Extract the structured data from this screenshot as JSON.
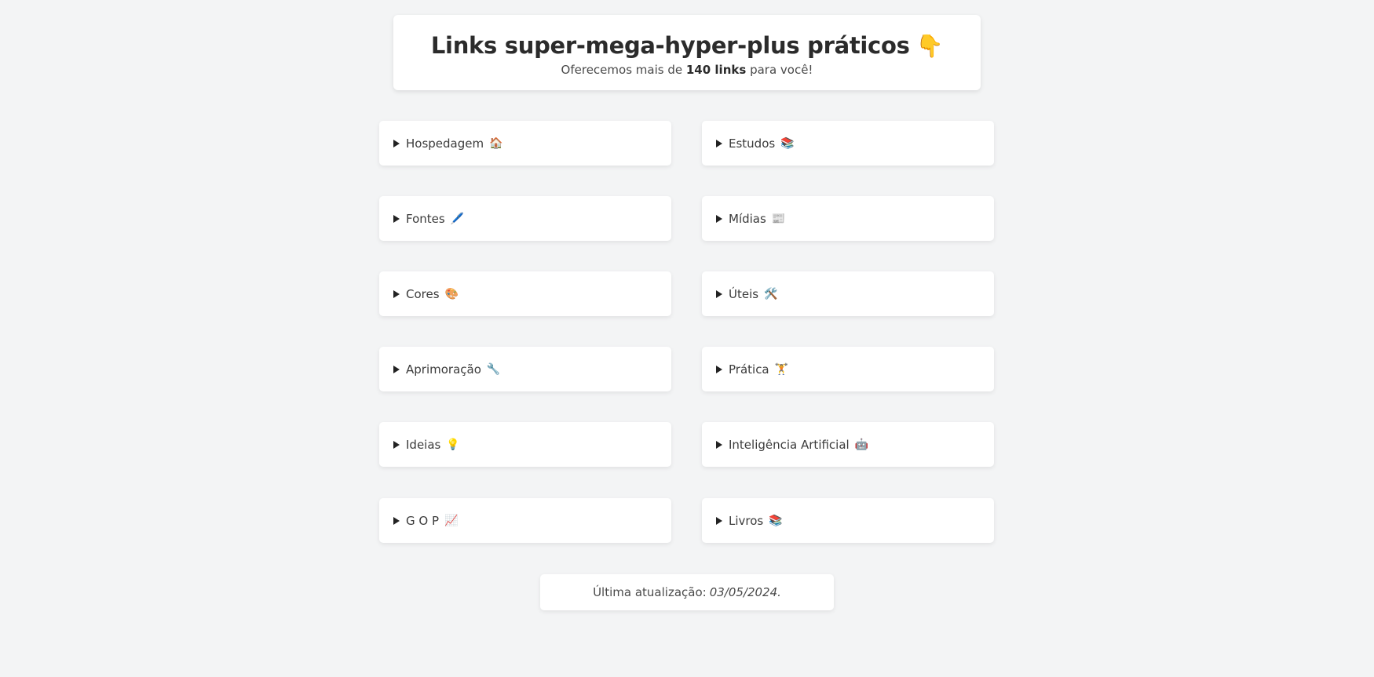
{
  "header": {
    "title": "Links super-mega-hyper-plus práticos",
    "title_emoji": "👇",
    "subtitle_prefix": "Oferecemos mais de",
    "subtitle_bold": "140 links",
    "subtitle_suffix": "para você!"
  },
  "cards": [
    {
      "label": "Hospedagem",
      "emoji": "🏠"
    },
    {
      "label": "Estudos",
      "emoji": "📚"
    },
    {
      "label": "Fontes",
      "emoji": "🖊️"
    },
    {
      "label": "Mídias",
      "emoji": "📰"
    },
    {
      "label": "Cores",
      "emoji": "🎨"
    },
    {
      "label": "Úteis",
      "emoji": "🛠️"
    },
    {
      "label": "Aprimoração",
      "emoji": "🔧"
    },
    {
      "label": "Prática",
      "emoji": "🏋️"
    },
    {
      "label": "Ideias",
      "emoji": "💡"
    },
    {
      "label": "Inteligência Artificial",
      "emoji": "🤖"
    },
    {
      "label": "G O P",
      "emoji": "📈"
    },
    {
      "label": "Livros",
      "emoji": "📚"
    }
  ],
  "footer": {
    "label": "Última atualização:",
    "date": "03/05/2024."
  }
}
